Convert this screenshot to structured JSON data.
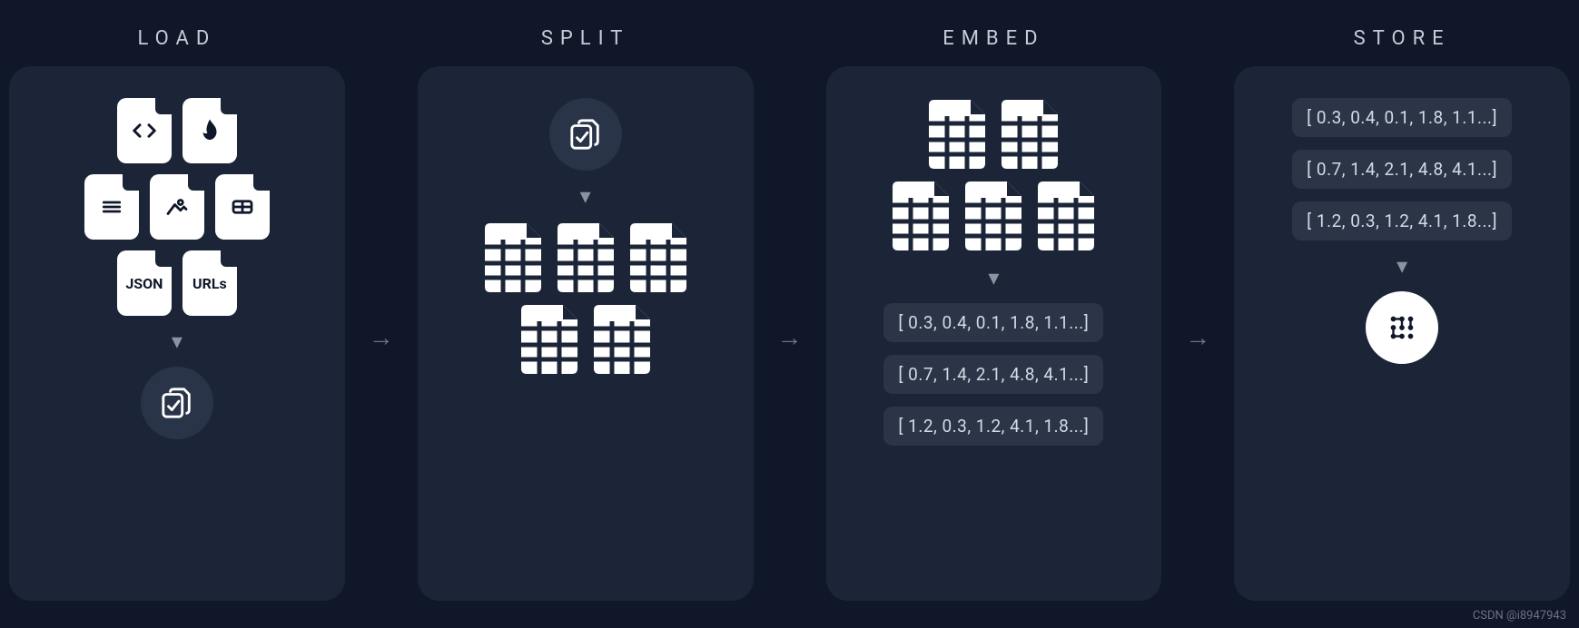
{
  "watermark": "CSDN @i8947943",
  "stages": {
    "load": {
      "title": "LOAD",
      "file_labels": {
        "json": "JSON",
        "urls": "URLs"
      }
    },
    "split": {
      "title": "SPLIT"
    },
    "embed": {
      "title": "EMBED",
      "vectors": [
        "[ 0.3, 0.4, 0.1, 1.8, 1.1...]",
        "[ 0.7, 1.4, 2.1, 4.8, 4.1...]",
        "[ 1.2, 0.3, 1.2, 4.1, 1.8...]"
      ]
    },
    "store": {
      "title": "STORE",
      "vectors": [
        "[ 0.3, 0.4, 0.1, 1.8, 1.1...]",
        "[ 0.7, 1.4, 2.1, 4.8, 4.1...]",
        "[ 1.2, 0.3, 1.2, 4.1, 1.8...]"
      ]
    }
  }
}
